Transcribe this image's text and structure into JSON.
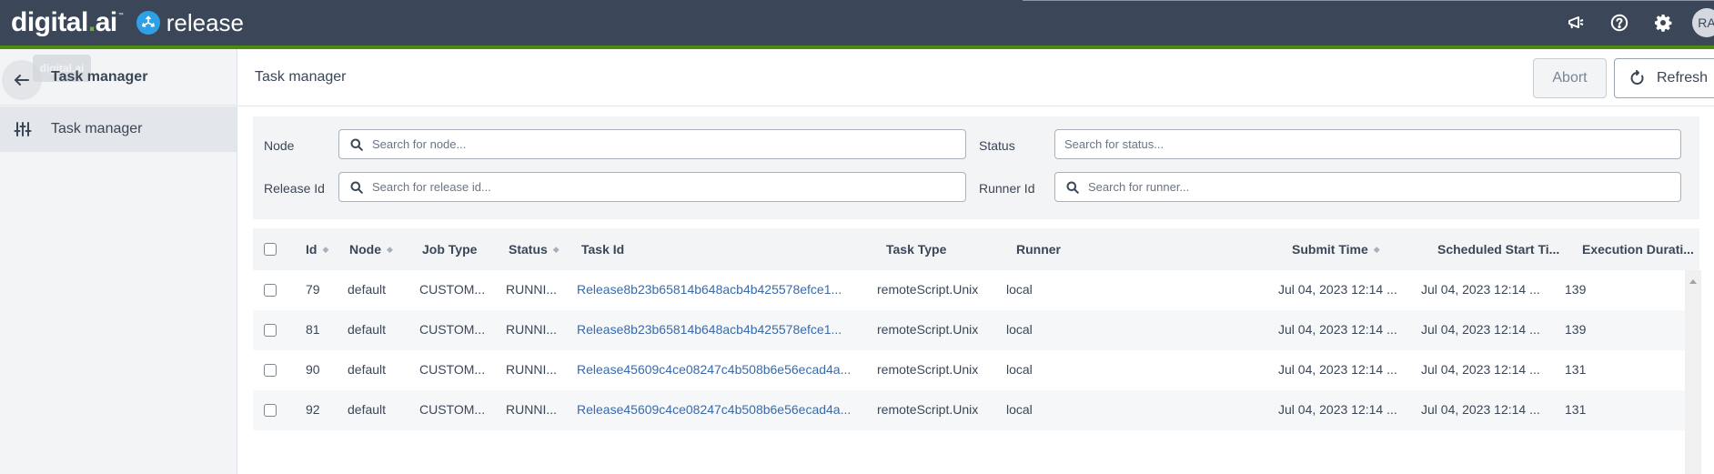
{
  "topbar": {
    "brand_digital_prefix": "digital",
    "brand_digital_dot": ".",
    "brand_digital_suffix": "ai",
    "brand_tm": "™",
    "brand_product": "release",
    "icons": [
      "megaphone-icon",
      "help-icon",
      "gear-icon"
    ],
    "avatar_initials": "RA",
    "accent_color": "#4f8a10"
  },
  "sidebar": {
    "tooltip": "digital.ai",
    "title": "Task manager",
    "items": [
      {
        "label": "Task manager",
        "icon": "sliders-icon",
        "selected": true
      }
    ]
  },
  "main": {
    "title": "Task manager",
    "buttons": {
      "abort": "Abort",
      "refresh": "Refresh"
    },
    "filters": {
      "node": {
        "label": "Node",
        "placeholder": "Search for node..."
      },
      "status": {
        "label": "Status",
        "placeholder": "Search for status..."
      },
      "release_id": {
        "label": "Release Id",
        "placeholder": "Search for release id..."
      },
      "runner_id": {
        "label": "Runner Id",
        "placeholder": "Search for runner..."
      }
    },
    "table": {
      "columns": [
        {
          "label": "Id",
          "sortable": true
        },
        {
          "label": "Node",
          "sortable": true
        },
        {
          "label": "Job Type",
          "sortable": false
        },
        {
          "label": "Status",
          "sortable": true
        },
        {
          "label": "Task Id",
          "sortable": false
        },
        {
          "label": "Task Type",
          "sortable": false
        },
        {
          "label": "Runner",
          "sortable": false
        },
        {
          "label": "Submit Time",
          "sortable": true
        },
        {
          "label": "Scheduled Start Ti...",
          "sortable": false
        },
        {
          "label": "Execution Durati...",
          "sortable": false
        }
      ],
      "rows": [
        {
          "id": "79",
          "node": "default",
          "job_type": "CUSTOM...",
          "status": "RUNNI...",
          "task_id": "Release8b23b65814b648acb4b425578efce1...",
          "task_type": "remoteScript.Unix",
          "runner": "local",
          "submit_time": "Jul 04, 2023 12:14 ...",
          "scheduled_start": "Jul 04, 2023 12:14 ...",
          "duration": "139"
        },
        {
          "id": "81",
          "node": "default",
          "job_type": "CUSTOM...",
          "status": "RUNNI...",
          "task_id": "Release8b23b65814b648acb4b425578efce1...",
          "task_type": "remoteScript.Unix",
          "runner": "local",
          "submit_time": "Jul 04, 2023 12:14 ...",
          "scheduled_start": "Jul 04, 2023 12:14 ...",
          "duration": "139"
        },
        {
          "id": "90",
          "node": "default",
          "job_type": "CUSTOM...",
          "status": "RUNNI...",
          "task_id": "Release45609c4ce08247c4b508b6e56ecad4a...",
          "task_type": "remoteScript.Unix",
          "runner": "local",
          "submit_time": "Jul 04, 2023 12:14 ...",
          "scheduled_start": "Jul 04, 2023 12:14 ...",
          "duration": "131"
        },
        {
          "id": "92",
          "node": "default",
          "job_type": "CUSTOM...",
          "status": "RUNNI...",
          "task_id": "Release45609c4ce08247c4b508b6e56ecad4a...",
          "task_type": "remoteScript.Unix",
          "runner": "local",
          "submit_time": "Jul 04, 2023 12:14 ...",
          "scheduled_start": "Jul 04, 2023 12:14 ...",
          "duration": "131"
        }
      ]
    }
  }
}
